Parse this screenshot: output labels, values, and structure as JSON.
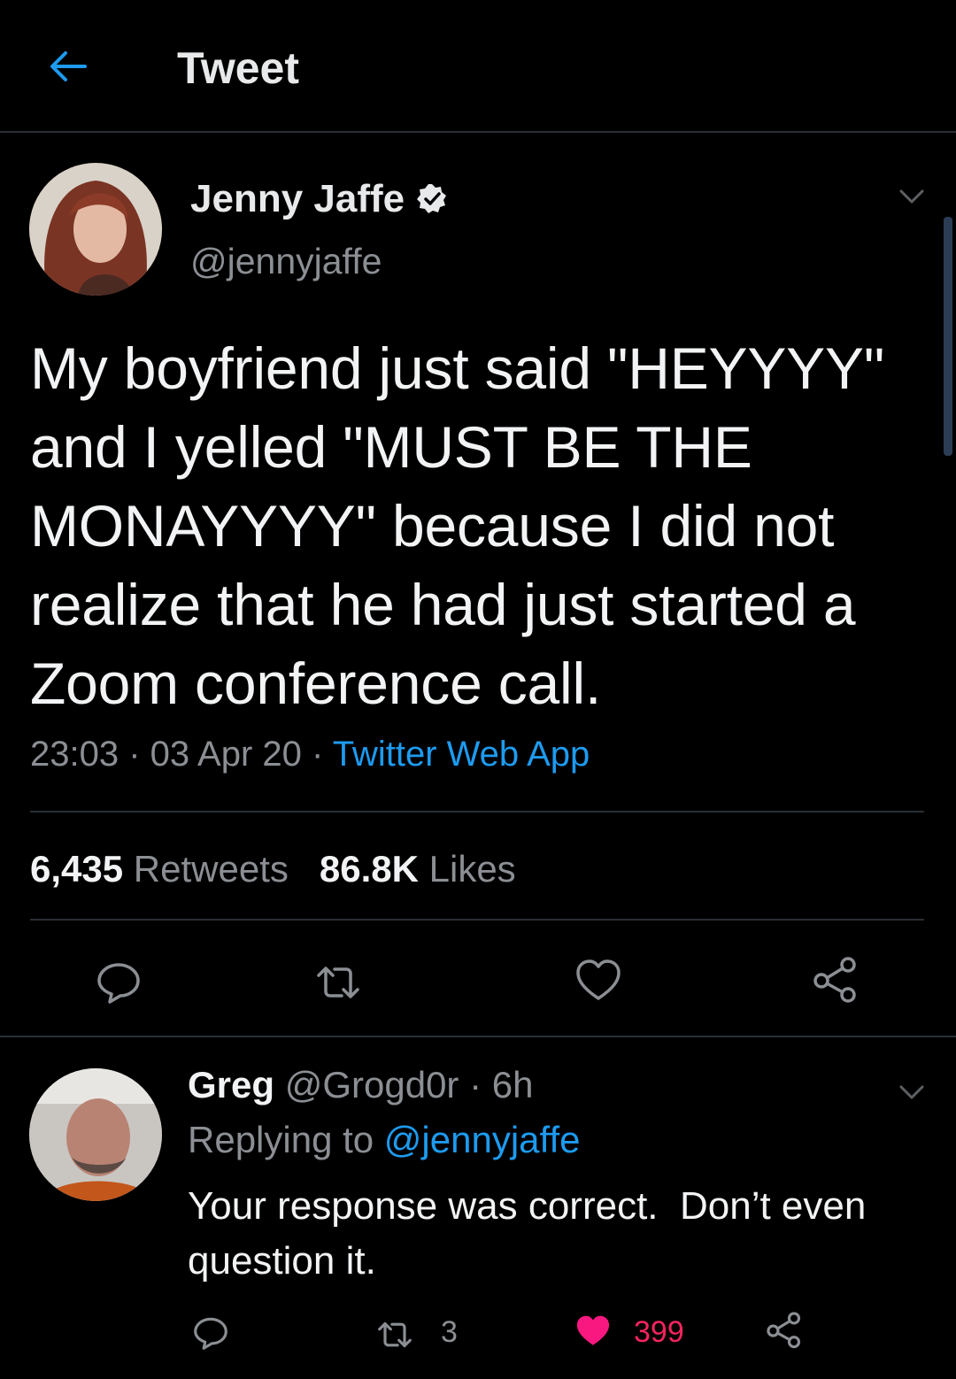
{
  "header": {
    "title": "Tweet"
  },
  "colors": {
    "background": "#000000",
    "accent": "#1d9bf0",
    "like": "#f91880",
    "muted": "#8b8f94"
  },
  "tweet": {
    "name": "Jenny Jaffe",
    "verified": true,
    "handle": "@jennyjaffe",
    "text": "My boyfriend just said \"HEYYYY\" and I yelled \"MUST BE THE MONAYYYY\" because I did not realize that he had just started a Zoom conference call.",
    "time": "23:03",
    "date": "03 Apr 20",
    "source": "Twitter Web App",
    "retweets": "6,435",
    "retweets_label": "Retweets",
    "likes": "86.8K",
    "likes_label": "Likes"
  },
  "reply": {
    "name": "Greg",
    "handle": "@Grogd0r",
    "age": "6h",
    "replying_label": "Replying to",
    "replying_to": "@jennyjaffe",
    "text": "Your response was correct.  Don’t even question it.",
    "retweets": "3",
    "likes": "399"
  },
  "icons": [
    "back-arrow-icon",
    "verified-badge-icon",
    "chevron-down-icon",
    "reply-icon",
    "retweet-icon",
    "heart-icon",
    "share-icon"
  ]
}
